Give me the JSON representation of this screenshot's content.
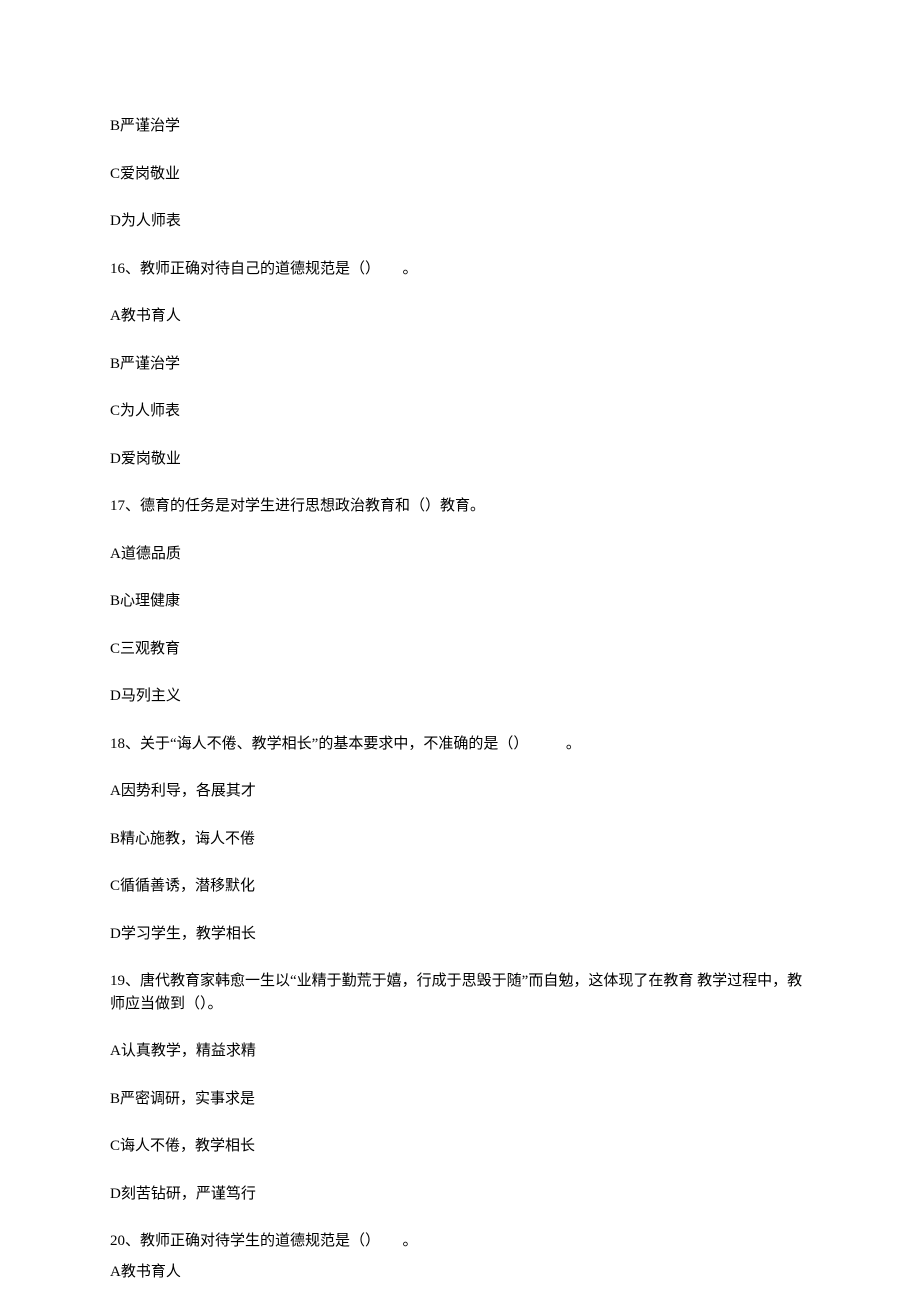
{
  "lines": [
    "B严谨治学",
    "C爱岗敬业",
    "D为人师表",
    "16、教师正确对待自己的道德规范是（）　　。",
    "A教书育人",
    "B严谨治学",
    "C为人师表",
    "D爱岗敬业",
    "17、德育的任务是对学生进行思想政治教育和（）教育。",
    "A道德品质",
    "B心理健康",
    "C三观教育",
    "D马列主义",
    "18、关于“诲人不倦、教学相长”的基本要求中，不准确的是（）　　　。",
    "A因势利导，各展其才",
    "B精心施教，诲人不倦",
    "C循循善诱，潜移默化",
    "D学习学生，教学相长",
    "19、唐代教育家韩愈一生以“业精于勤荒于嬉，行成于思毁于随”而自勉，这体现了在教育 教学过程中，教师应当做到（）。",
    "A认真教学，精益求精",
    "B严密调研，实事求是",
    "C诲人不倦，教学相长",
    "D刻苦钻研，严谨笃行",
    "20、教师正确对待学生的道德规范是（）　　。",
    "A教书育人"
  ]
}
